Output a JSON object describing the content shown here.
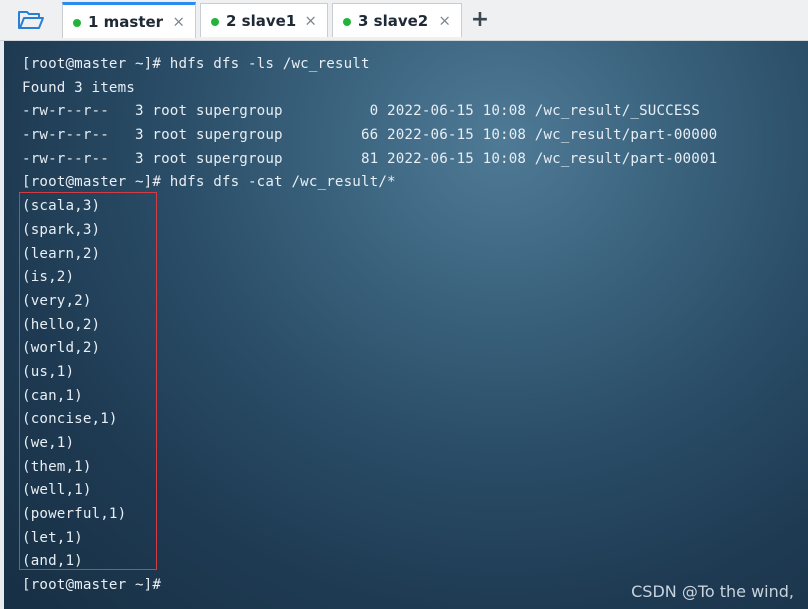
{
  "toolbar": {
    "open_folder_icon": "folder-open-icon",
    "add_tab_label": "+"
  },
  "tabs": [
    {
      "label": "1 master",
      "active": true,
      "status": "connected"
    },
    {
      "label": "2 slave1",
      "active": false,
      "status": "connected"
    },
    {
      "label": "3 slave2",
      "active": false,
      "status": "connected"
    }
  ],
  "tab_close_label": "×",
  "terminal": {
    "lines": [
      "[root@master ~]# hdfs dfs -ls /wc_result",
      "Found 3 items",
      "-rw-r--r--   3 root supergroup          0 2022-06-15 10:08 /wc_result/_SUCCESS",
      "-rw-r--r--   3 root supergroup         66 2022-06-15 10:08 /wc_result/part-00000",
      "-rw-r--r--   3 root supergroup         81 2022-06-15 10:08 /wc_result/part-00001",
      "[root@master ~]# hdfs dfs -cat /wc_result/*",
      "(scala,3)",
      "(spark,3)",
      "(learn,2)",
      "(is,2)",
      "(very,2)",
      "(hello,2)",
      "(world,2)",
      "(us,1)",
      "(can,1)",
      "(concise,1)",
      "(we,1)",
      "(them,1)",
      "(well,1)",
      "(powerful,1)",
      "(let,1)",
      "(and,1)",
      "[root@master ~]# "
    ]
  },
  "watermark": "CSDN @To the wind,",
  "colors": {
    "active_tab_accent": "#2a8cf0",
    "status_dot": "#22b43a",
    "highlight_box": "#d43c44",
    "terminal_text": "#e8eef3"
  }
}
